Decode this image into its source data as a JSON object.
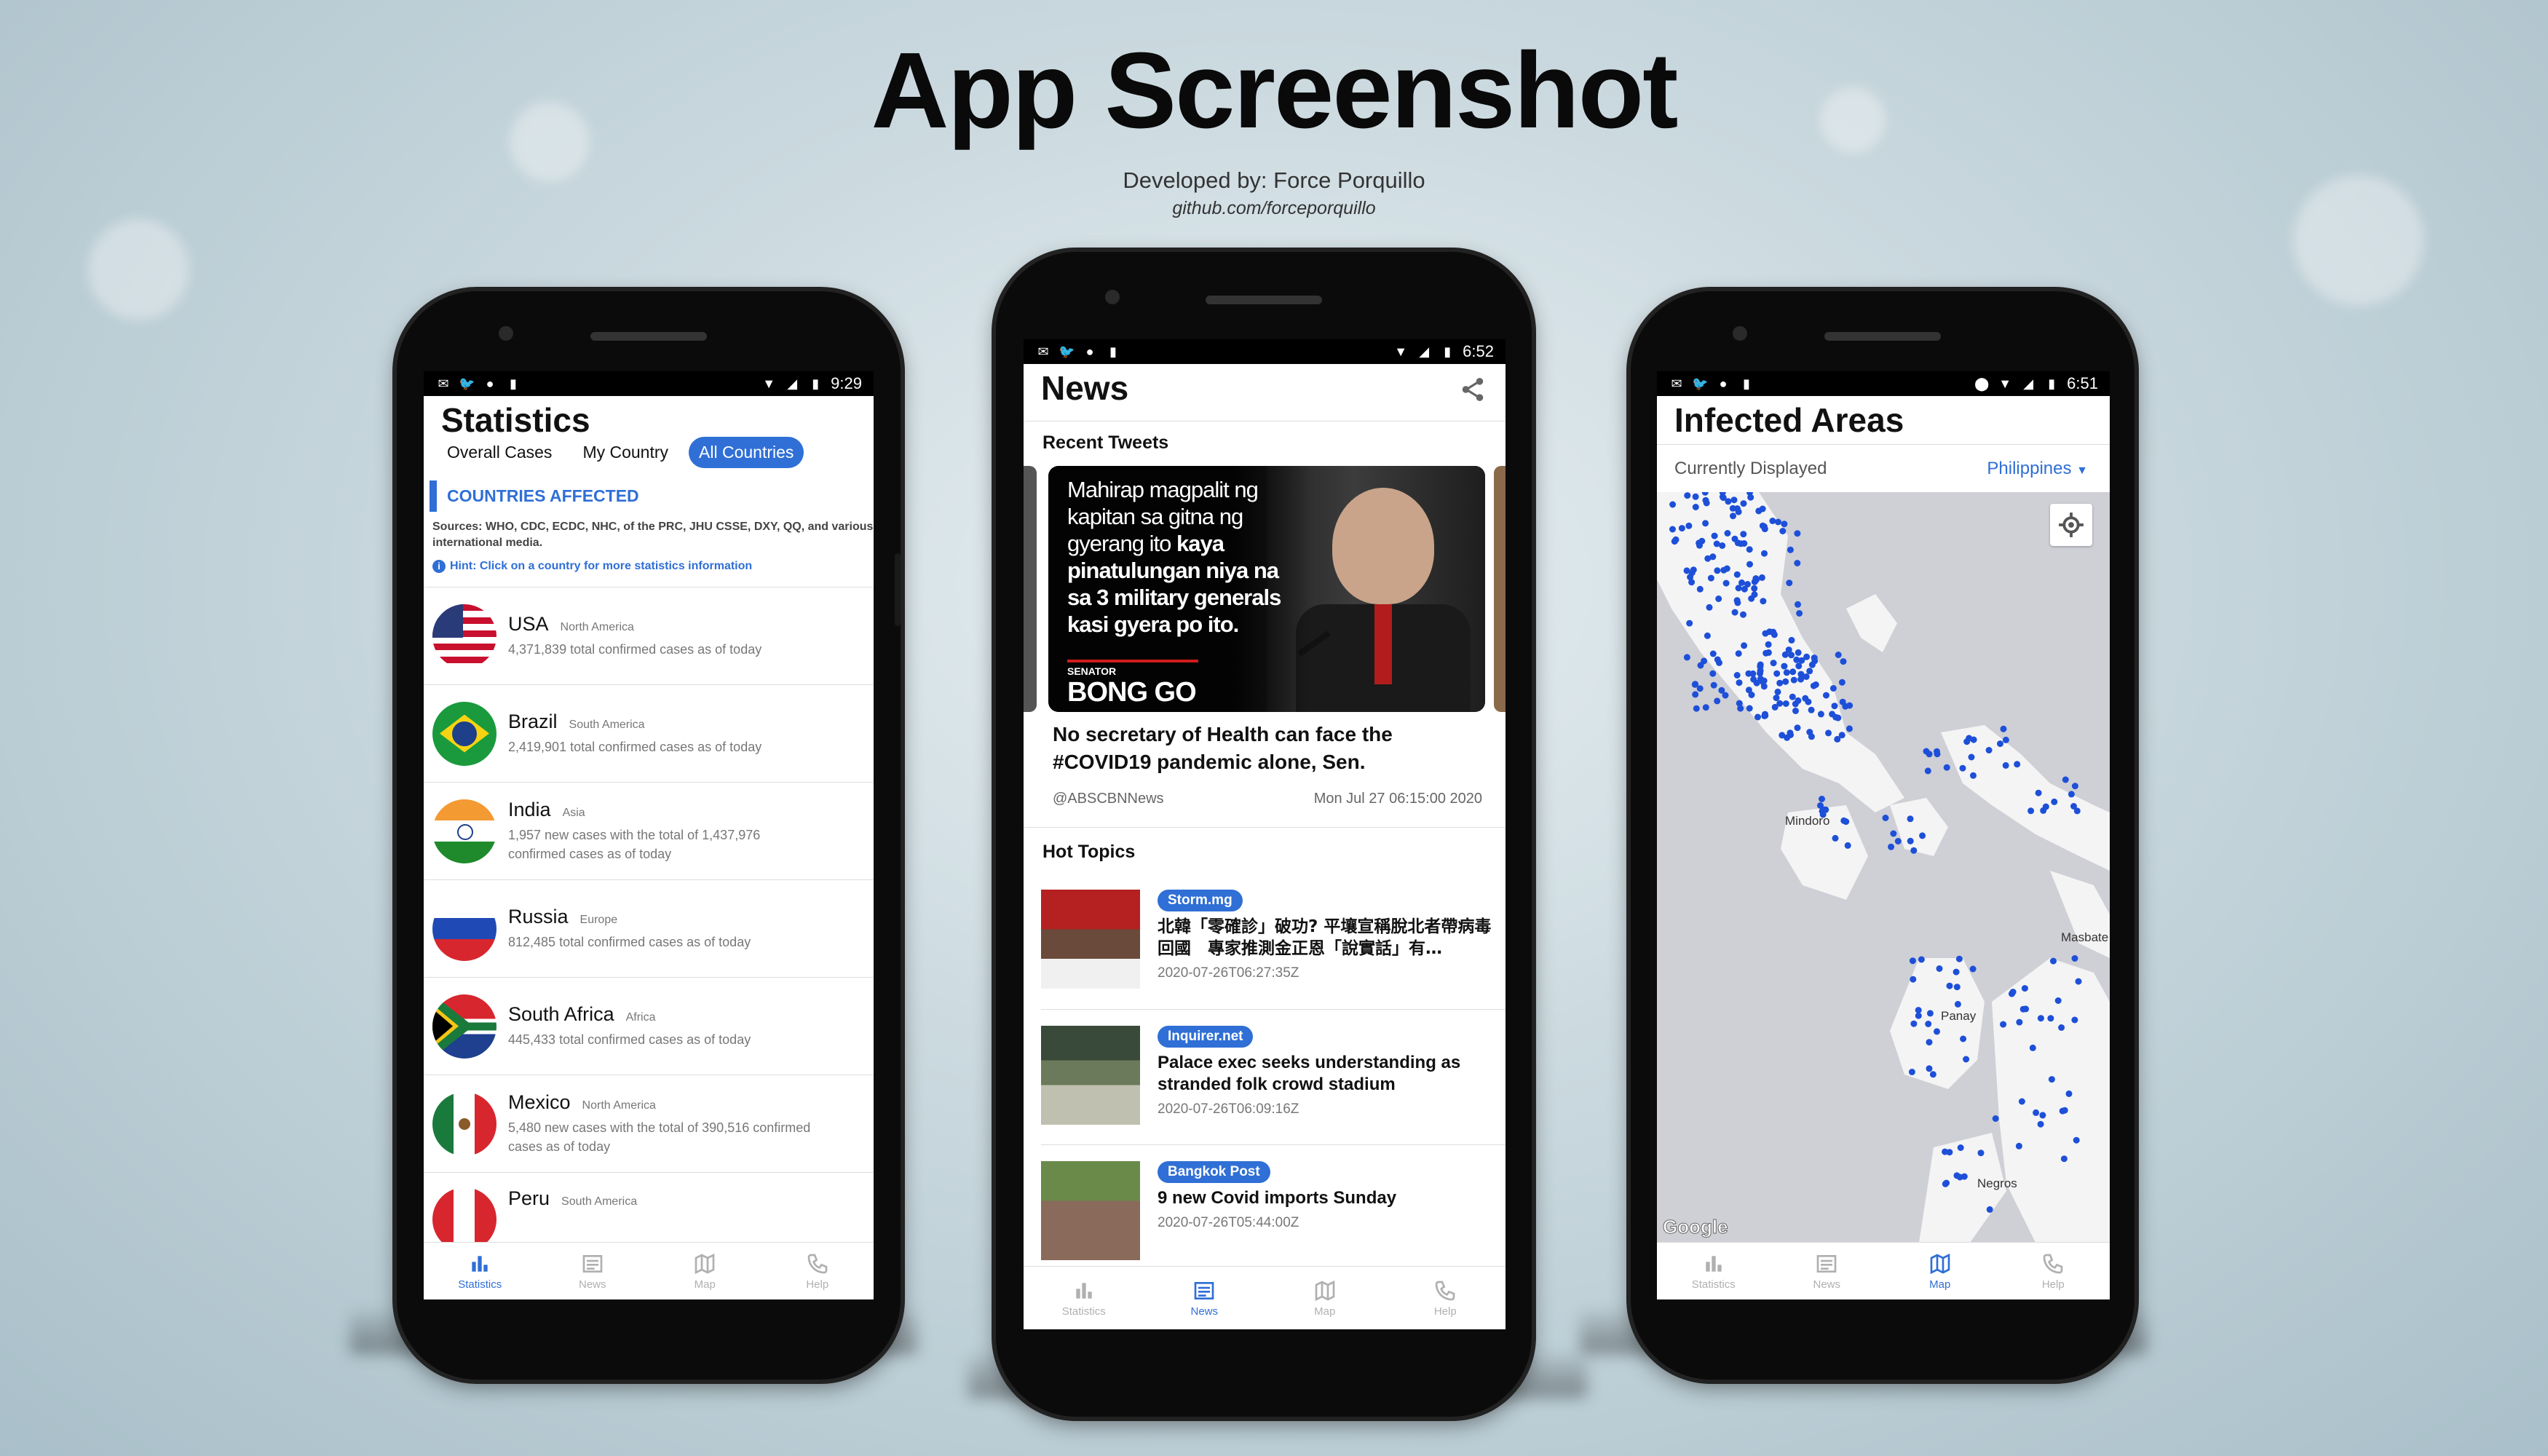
{
  "header": {
    "title": "App Screenshot",
    "developer": "Developed by: Force Porquillo",
    "github": "github.com/forceporquillo"
  },
  "colors": {
    "accent": "#2f6fd6",
    "text": "#111111",
    "muted": "#777777"
  },
  "nav": {
    "statistics": "Statistics",
    "news": "News",
    "map": "Map",
    "help": "Help"
  },
  "phone1": {
    "time": "9:29",
    "title": "Statistics",
    "tabs": [
      "Overall Cases",
      "My Country",
      "All Countries"
    ],
    "section_title": "COUNTRIES AFFECTED",
    "sources": "Sources: WHO, CDC, ECDC, NHC, of the PRC, JHU CSSE, DXY, QQ, and various international media.",
    "hint": "Hint: Click on a country for more statistics information",
    "countries": [
      {
        "name": "USA",
        "region": "North America",
        "desc": "4,371,839 total confirmed cases as of today",
        "flag": "usa"
      },
      {
        "name": "Brazil",
        "region": "South America",
        "desc": "2,419,901 total confirmed cases as of today",
        "flag": "brazil"
      },
      {
        "name": "India",
        "region": "Asia",
        "desc": "1,957 new cases with the total of 1,437,976 confirmed cases as of today",
        "flag": "india"
      },
      {
        "name": "Russia",
        "region": "Europe",
        "desc": "812,485 total confirmed cases as of today",
        "flag": "russia"
      },
      {
        "name": "South Africa",
        "region": "Africa",
        "desc": "445,433 total confirmed cases as of today",
        "flag": "south-africa"
      },
      {
        "name": "Mexico",
        "region": "North America",
        "desc": "5,480 new cases with the total of 390,516 confirmed cases as of today",
        "flag": "mexico"
      },
      {
        "name": "Peru",
        "region": "South America",
        "desc": "",
        "flag": "peru"
      }
    ]
  },
  "phone2": {
    "time": "6:52",
    "title": "News",
    "recent_tweets": "Recent Tweets",
    "tweet": {
      "image_text_1": "Mahirap magpalit ng kapitan sa gitna ng gyerang ito ",
      "image_text_bold": "kaya pinatulungan niya na sa 3 military generals kasi gyera po ito.",
      "senator_label": "SENATOR",
      "senator_name": "BONG GO",
      "caption": "No secretary of Health can face the #COVID19 pandemic alone, Sen.",
      "handle": "@ABSCBNNews",
      "time": "Mon Jul 27 06:15:00 2020"
    },
    "hot_topics": "Hot Topics",
    "topics": [
      {
        "source": "Storm.mg",
        "title": "北韓「零確診」破功? 平壤宣稱脫北者帶病毒回國　專家推測金正恩「說實話」有…",
        "date": "2020-07-26T06:27:35Z"
      },
      {
        "source": "Inquirer.net",
        "title": "Palace exec seeks understanding as stranded folk crowd stadium",
        "date": "2020-07-26T06:09:16Z"
      },
      {
        "source": "Bangkok Post",
        "title": "9 new Covid imports Sunday",
        "date": "2020-07-26T05:44:00Z"
      }
    ]
  },
  "phone3": {
    "time": "6:51",
    "title": "Infected Areas",
    "currently_displayed": "Currently Displayed",
    "selected_country": "Philippines",
    "map_labels": [
      "Mindoro",
      "Masbate",
      "Panay",
      "Negros"
    ],
    "map_attribution": "Google"
  }
}
